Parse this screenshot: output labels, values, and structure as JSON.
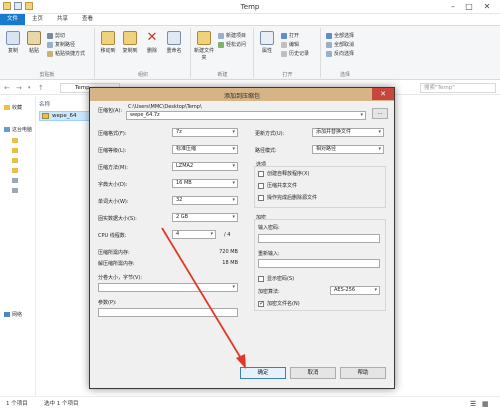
{
  "window": {
    "title": "Temp",
    "menu": [
      "文件",
      "主页",
      "共享",
      "查看"
    ]
  },
  "ribbon": {
    "clipboard": {
      "label": "剪贴板",
      "copy": "复制",
      "paste": "粘贴",
      "cut": "剪切",
      "copy_path": "复制路径",
      "paste_shortcut": "粘贴快捷方式"
    },
    "organize": {
      "label": "组织",
      "move_to": "移动到",
      "copy_to": "复制到",
      "delete": "删除",
      "rename": "重命名"
    },
    "new": {
      "label": "新建",
      "new_folder": "新建文件夹",
      "new_item": "新建项目",
      "easy_access": "轻松访问"
    },
    "open": {
      "label": "打开",
      "properties": "属性",
      "open": "打开",
      "edit": "编辑",
      "history": "历史记录"
    },
    "select": {
      "label": "选择",
      "select_all": "全部选择",
      "select_none": "全部取消",
      "invert": "反向选择"
    }
  },
  "address": {
    "path": "Temp",
    "search_placeholder": "搜索\"Temp\""
  },
  "nav": {
    "items": [
      "收藏",
      "这台电脑",
      "网络"
    ]
  },
  "filelist": {
    "column_name": "名称",
    "file": "wepe_64"
  },
  "status": {
    "items": "1 个项目",
    "selected": "选中 1 个项目"
  },
  "dialog": {
    "title": "添加到压缩包",
    "archive_label": "压缩包(A):",
    "archive_path": "C:\\Users\\MMC\\Desktop\\Temp\\",
    "archive_name": "wepe_64.7z",
    "browse": "...",
    "format_label": "压缩格式(F):",
    "format_value": "7z",
    "level_label": "压缩等级(L):",
    "level_value": "标准压缩",
    "method_label": "压缩方法(M):",
    "method_value": "LZMA2",
    "dict_label": "字典大小(D):",
    "dict_value": "16 MB",
    "word_label": "单词大小(W):",
    "word_value": "32",
    "solid_label": "固实数据大小(S):",
    "solid_value": "2 GB",
    "cpu_label": "CPU 线程数:",
    "cpu_value": "4",
    "cpu_max": "/ 4",
    "mem_comp_label": "压缩所需内存:",
    "mem_comp_value": "720 MB",
    "mem_decomp_label": "解压缩所需内存:",
    "mem_decomp_value": "18 MB",
    "split_label": "分卷大小，字节(V):",
    "params_label": "参数(P):",
    "update_label": "更新方式(U):",
    "update_value": "添加并替换文件",
    "pathmode_label": "路径模式:",
    "pathmode_value": "相对路径",
    "options_label": "选项",
    "opt_sfx": "创建自释放程序(X)",
    "opt_shared": "压缩共享文件",
    "opt_delete": "操作完成后删除源文件",
    "encrypt_label": "加密",
    "pwd_label": "输入密码:",
    "pwd2_label": "重新输入:",
    "show_pwd": "显示密码(S)",
    "enc_method_label": "加密算法:",
    "enc_method_value": "AES-256",
    "enc_names": "加密文件名(N)",
    "ok": "确定",
    "cancel": "取消",
    "help": "帮助"
  },
  "annotation_color": "#e0392b"
}
